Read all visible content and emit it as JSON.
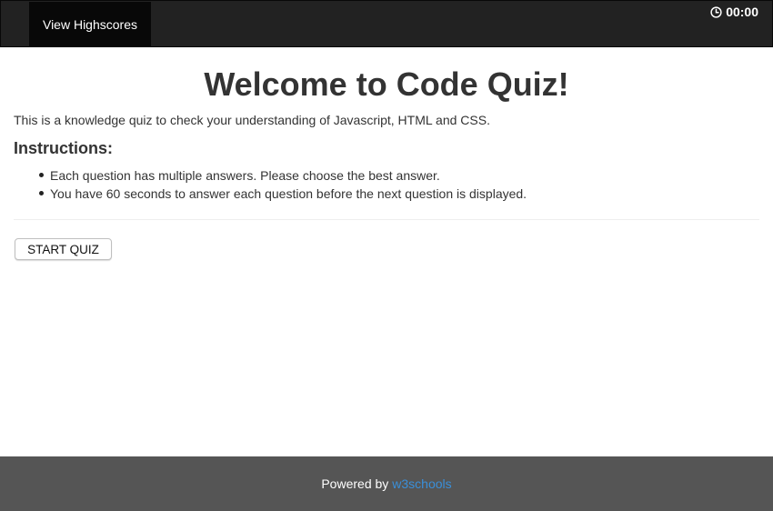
{
  "nav": {
    "highscores_label": "View Highscores",
    "timer": "00:00",
    "timer_icon": "clock-icon"
  },
  "main": {
    "title": "Welcome to Code Quiz!",
    "intro": "This is a knowledge quiz to check your understanding of Javascript, HTML and CSS.",
    "instructions_heading": "Instructions:",
    "instructions": [
      "Each question has multiple answers. Please choose the best answer.",
      "You have 60 seconds to answer each question before the next question is displayed."
    ],
    "start_button": "START QUIZ"
  },
  "footer": {
    "prefix": "Powered by",
    "link_text": "w3schools"
  },
  "colors": {
    "navbar": "#222222",
    "nav_active": "#080808",
    "footer": "#555555",
    "link": "#3a8fd9"
  }
}
